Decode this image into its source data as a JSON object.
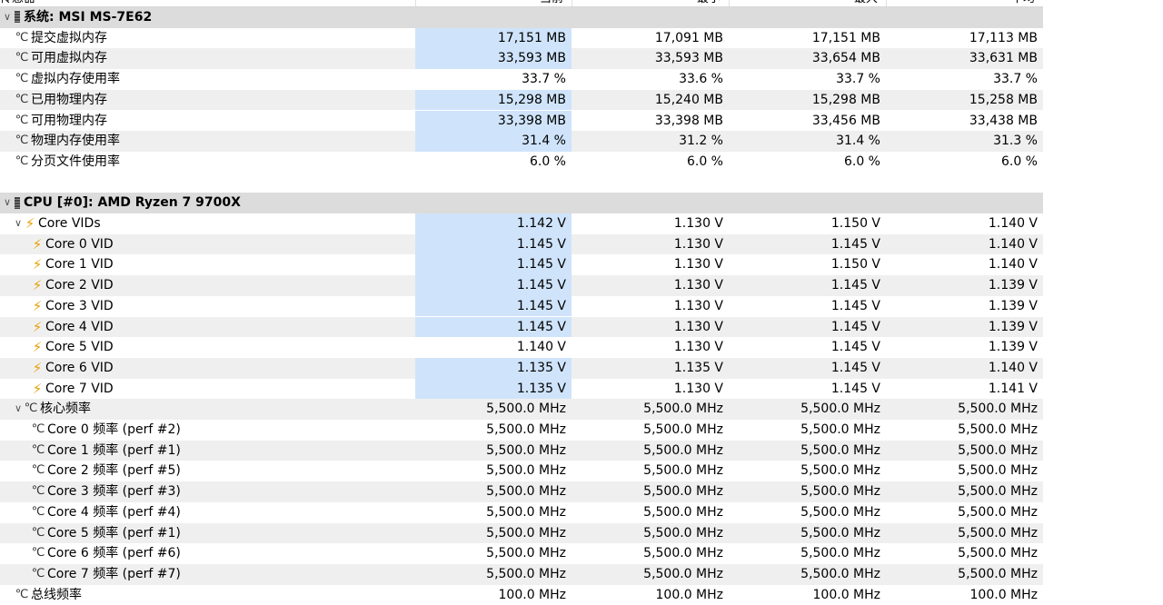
{
  "header": {
    "columns": [
      "传感器",
      "当前",
      "最小",
      "最大",
      "平均"
    ]
  },
  "sections": [
    {
      "device": "系统: MSI MS-7E62",
      "rows": [
        {
          "name": "提交虚拟内存",
          "icon": "gauge-icon",
          "values": [
            "17,151 MB",
            "17,091 MB",
            "17,151 MB",
            "17,113 MB"
          ],
          "highlight": true
        },
        {
          "name": "可用虚拟内存",
          "icon": "gauge-icon",
          "values": [
            "33,593 MB",
            "33,593 MB",
            "33,654 MB",
            "33,631 MB"
          ],
          "highlight": true
        },
        {
          "name": "虚拟内存使用率",
          "icon": "gauge-icon",
          "values": [
            "33.7 %",
            "33.6 %",
            "33.7 %",
            "33.7 %"
          ],
          "highlight": false
        },
        {
          "name": "已用物理内存",
          "icon": "gauge-icon",
          "values": [
            "15,298 MB",
            "15,240 MB",
            "15,298 MB",
            "15,258 MB"
          ],
          "highlight": true
        },
        {
          "name": "可用物理内存",
          "icon": "gauge-icon",
          "values": [
            "33,398 MB",
            "33,398 MB",
            "33,456 MB",
            "33,438 MB"
          ],
          "highlight": true
        },
        {
          "name": "物理内存使用率",
          "icon": "gauge-icon",
          "values": [
            "31.4 %",
            "31.2 %",
            "31.4 %",
            "31.3 %"
          ],
          "highlight": true
        },
        {
          "name": "分页文件使用率",
          "icon": "gauge-icon",
          "values": [
            "6.0 %",
            "6.0 %",
            "6.0 %",
            "6.0 %"
          ],
          "highlight": false
        }
      ]
    },
    {
      "device": "CPU [#0]: AMD Ryzen 7 9700X",
      "rows": [
        {
          "name": "Core VIDs",
          "icon": "bolt-icon",
          "group": true,
          "values": [
            "1.142 V",
            "1.130 V",
            "1.150 V",
            "1.140 V"
          ],
          "highlight": true
        },
        {
          "name": "Core 0 VID",
          "icon": "bolt-icon",
          "values": [
            "1.145 V",
            "1.130 V",
            "1.145 V",
            "1.140 V"
          ],
          "highlight": true
        },
        {
          "name": "Core 1 VID",
          "icon": "bolt-icon",
          "values": [
            "1.145 V",
            "1.130 V",
            "1.150 V",
            "1.140 V"
          ],
          "highlight": true
        },
        {
          "name": "Core 2 VID",
          "icon": "bolt-icon",
          "values": [
            "1.145 V",
            "1.130 V",
            "1.145 V",
            "1.139 V"
          ],
          "highlight": true
        },
        {
          "name": "Core 3 VID",
          "icon": "bolt-icon",
          "values": [
            "1.145 V",
            "1.130 V",
            "1.145 V",
            "1.139 V"
          ],
          "highlight": true
        },
        {
          "name": "Core 4 VID",
          "icon": "bolt-icon",
          "values": [
            "1.145 V",
            "1.130 V",
            "1.145 V",
            "1.139 V"
          ],
          "highlight": true
        },
        {
          "name": "Core 5 VID",
          "icon": "bolt-icon",
          "values": [
            "1.140 V",
            "1.130 V",
            "1.145 V",
            "1.139 V"
          ],
          "highlight": false
        },
        {
          "name": "Core 6 VID",
          "icon": "bolt-icon",
          "values": [
            "1.135 V",
            "1.135 V",
            "1.145 V",
            "1.140 V"
          ],
          "highlight": true
        },
        {
          "name": "Core 7 VID",
          "icon": "bolt-icon",
          "values": [
            "1.135 V",
            "1.130 V",
            "1.145 V",
            "1.141 V"
          ],
          "highlight": true
        },
        {
          "name": "核心频率",
          "icon": "gauge-icon",
          "group": true,
          "values": [
            "5,500.0 MHz",
            "5,500.0 MHz",
            "5,500.0 MHz",
            "5,500.0 MHz"
          ],
          "highlight": false
        },
        {
          "name": "Core 0 频率 (perf #2)",
          "icon": "gauge-icon",
          "values": [
            "5,500.0 MHz",
            "5,500.0 MHz",
            "5,500.0 MHz",
            "5,500.0 MHz"
          ],
          "highlight": false
        },
        {
          "name": "Core 1 频率 (perf #1)",
          "icon": "gauge-icon",
          "values": [
            "5,500.0 MHz",
            "5,500.0 MHz",
            "5,500.0 MHz",
            "5,500.0 MHz"
          ],
          "highlight": false
        },
        {
          "name": "Core 2 频率 (perf #5)",
          "icon": "gauge-icon",
          "values": [
            "5,500.0 MHz",
            "5,500.0 MHz",
            "5,500.0 MHz",
            "5,500.0 MHz"
          ],
          "highlight": false
        },
        {
          "name": "Core 3 频率 (perf #3)",
          "icon": "gauge-icon",
          "values": [
            "5,500.0 MHz",
            "5,500.0 MHz",
            "5,500.0 MHz",
            "5,500.0 MHz"
          ],
          "highlight": false
        },
        {
          "name": "Core 4 频率 (perf #4)",
          "icon": "gauge-icon",
          "values": [
            "5,500.0 MHz",
            "5,500.0 MHz",
            "5,500.0 MHz",
            "5,500.0 MHz"
          ],
          "highlight": false
        },
        {
          "name": "Core 5 频率 (perf #1)",
          "icon": "gauge-icon",
          "values": [
            "5,500.0 MHz",
            "5,500.0 MHz",
            "5,500.0 MHz",
            "5,500.0 MHz"
          ],
          "highlight": false
        },
        {
          "name": "Core 6 频率 (perf #6)",
          "icon": "gauge-icon",
          "values": [
            "5,500.0 MHz",
            "5,500.0 MHz",
            "5,500.0 MHz",
            "5,500.0 MHz"
          ],
          "highlight": false
        },
        {
          "name": "Core 7 频率 (perf #7)",
          "icon": "gauge-icon",
          "values": [
            "5,500.0 MHz",
            "5,500.0 MHz",
            "5,500.0 MHz",
            "5,500.0 MHz"
          ],
          "highlight": false
        },
        {
          "name": "总线频率",
          "icon": "gauge-icon",
          "values": [
            "100.0 MHz",
            "100.0 MHz",
            "100.0 MHz",
            "100.0 MHz"
          ],
          "highlight": false
        }
      ]
    }
  ]
}
